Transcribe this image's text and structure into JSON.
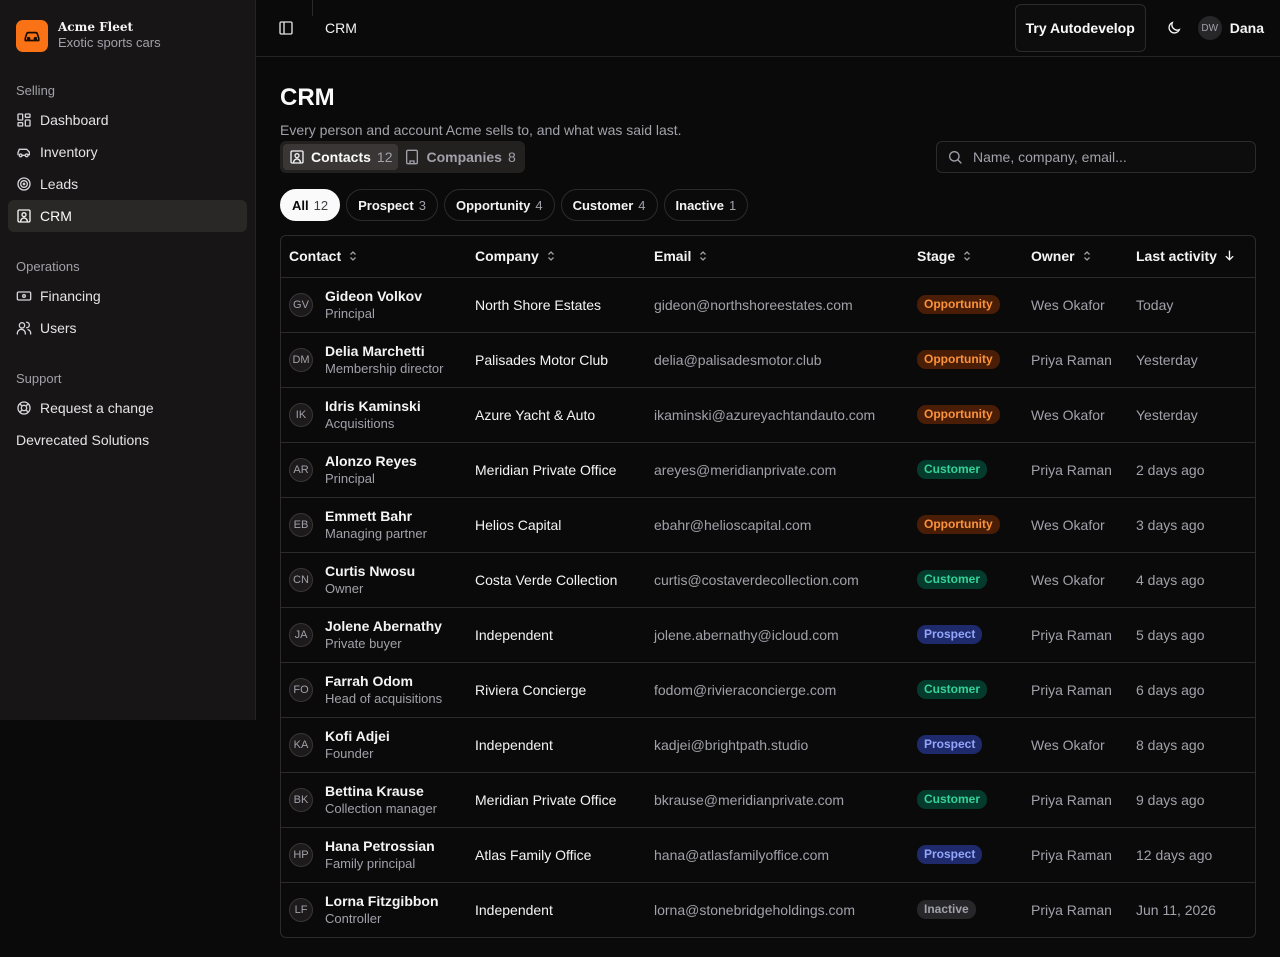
{
  "brand": {
    "name": "Acme Fleet",
    "subtitle": "Exotic sports cars"
  },
  "sidebar": {
    "groups": [
      {
        "title": "Selling",
        "items": [
          {
            "label": "Dashboard",
            "icon": "dashboard-icon"
          },
          {
            "label": "Inventory",
            "icon": "car-icon"
          },
          {
            "label": "Leads",
            "icon": "target-icon"
          },
          {
            "label": "CRM",
            "icon": "contact-icon",
            "active": true
          }
        ]
      },
      {
        "title": "Operations",
        "items": [
          {
            "label": "Financing",
            "icon": "banknote-icon"
          },
          {
            "label": "Users",
            "icon": "users-icon"
          }
        ]
      },
      {
        "title": "Support",
        "items": [
          {
            "label": "Request a change",
            "icon": "life-buoy-icon"
          },
          {
            "label": "Devrecated Solutions"
          }
        ]
      }
    ]
  },
  "header": {
    "breadcrumb": "CRM",
    "autodevelop_label": "Try Autodevelop",
    "user_initials": "DW",
    "user_name": "Dana"
  },
  "page": {
    "title": "CRM",
    "subtitle": "Every person and account Acme sells to, and what was said last."
  },
  "tabs": [
    {
      "label": "Contacts",
      "count": "12",
      "active": true
    },
    {
      "label": "Companies",
      "count": "8"
    }
  ],
  "search": {
    "placeholder": "Name, company, email..."
  },
  "filters": [
    {
      "label": "All",
      "count": "12",
      "active": true
    },
    {
      "label": "Prospect",
      "count": "3"
    },
    {
      "label": "Opportunity",
      "count": "4"
    },
    {
      "label": "Customer",
      "count": "4"
    },
    {
      "label": "Inactive",
      "count": "1"
    }
  ],
  "table": {
    "columns": [
      "Contact",
      "Company",
      "Email",
      "Stage",
      "Owner",
      "Last activity"
    ],
    "rows": [
      {
        "initials": "GV",
        "name": "Gideon Volkov",
        "title": "Principal",
        "company": "North Shore Estates",
        "email": "gideon@northshoreestates.com",
        "stage": "Opportunity",
        "owner": "Wes Okafor",
        "last": "Today"
      },
      {
        "initials": "DM",
        "name": "Delia Marchetti",
        "title": "Membership director",
        "company": "Palisades Motor Club",
        "email": "delia@palisadesmotor.club",
        "stage": "Opportunity",
        "owner": "Priya Raman",
        "last": "Yesterday"
      },
      {
        "initials": "IK",
        "name": "Idris Kaminski",
        "title": "Acquisitions",
        "company": "Azure Yacht & Auto",
        "email": "ikaminski@azureyachtandauto.com",
        "stage": "Opportunity",
        "owner": "Wes Okafor",
        "last": "Yesterday"
      },
      {
        "initials": "AR",
        "name": "Alonzo Reyes",
        "title": "Principal",
        "company": "Meridian Private Office",
        "email": "areyes@meridianprivate.com",
        "stage": "Customer",
        "owner": "Priya Raman",
        "last": "2 days ago"
      },
      {
        "initials": "EB",
        "name": "Emmett Bahr",
        "title": "Managing partner",
        "company": "Helios Capital",
        "email": "ebahr@helioscapital.com",
        "stage": "Opportunity",
        "owner": "Wes Okafor",
        "last": "3 days ago"
      },
      {
        "initials": "CN",
        "name": "Curtis Nwosu",
        "title": "Owner",
        "company": "Costa Verde Collection",
        "email": "curtis@costaverdecollection.com",
        "stage": "Customer",
        "owner": "Wes Okafor",
        "last": "4 days ago"
      },
      {
        "initials": "JA",
        "name": "Jolene Abernathy",
        "title": "Private buyer",
        "company": "Independent",
        "email": "jolene.abernathy@icloud.com",
        "stage": "Prospect",
        "owner": "Priya Raman",
        "last": "5 days ago"
      },
      {
        "initials": "FO",
        "name": "Farrah Odom",
        "title": "Head of acquisitions",
        "company": "Riviera Concierge",
        "email": "fodom@rivieraconcierge.com",
        "stage": "Customer",
        "owner": "Priya Raman",
        "last": "6 days ago"
      },
      {
        "initials": "KA",
        "name": "Kofi Adjei",
        "title": "Founder",
        "company": "Independent",
        "email": "kadjei@brightpath.studio",
        "stage": "Prospect",
        "owner": "Wes Okafor",
        "last": "8 days ago"
      },
      {
        "initials": "BK",
        "name": "Bettina Krause",
        "title": "Collection manager",
        "company": "Meridian Private Office",
        "email": "bkrause@meridianprivate.com",
        "stage": "Customer",
        "owner": "Priya Raman",
        "last": "9 days ago"
      },
      {
        "initials": "HP",
        "name": "Hana Petrossian",
        "title": "Family principal",
        "company": "Atlas Family Office",
        "email": "hana@atlasfamilyoffice.com",
        "stage": "Prospect",
        "owner": "Priya Raman",
        "last": "12 days ago"
      },
      {
        "initials": "LF",
        "name": "Lorna Fitzgibbon",
        "title": "Controller",
        "company": "Independent",
        "email": "lorna@stonebridgeholdings.com",
        "stage": "Inactive",
        "owner": "Priya Raman",
        "last": "Jun 11, 2026"
      }
    ]
  },
  "colors": {
    "accent": "#f97316",
    "background": "#0b0a0a",
    "sidebar": "#171515"
  }
}
